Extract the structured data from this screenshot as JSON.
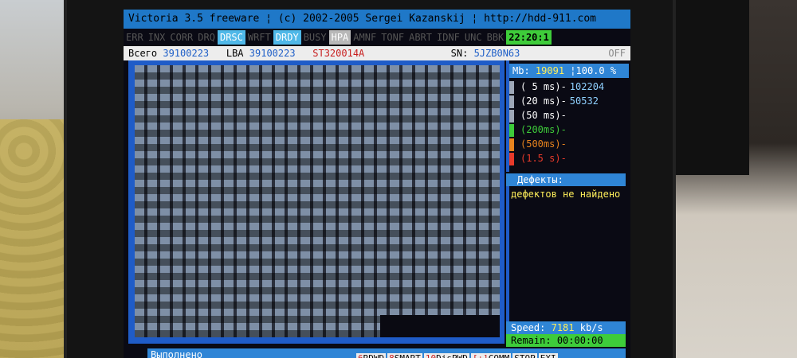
{
  "title": "Victoria 3.5 freeware ¦  (c) 2002-2005  Sergei Kazanskij  ¦ http://hdd-911.com",
  "flags": [
    {
      "label": "ERR",
      "state": "off"
    },
    {
      "label": "INX",
      "state": "off"
    },
    {
      "label": "CORR",
      "state": "off"
    },
    {
      "label": "DRQ",
      "state": "off"
    },
    {
      "label": "DRSC",
      "state": "on"
    },
    {
      "label": "WRFT",
      "state": "off"
    },
    {
      "label": "DRDY",
      "state": "on"
    },
    {
      "label": "BUSY",
      "state": "off"
    },
    {
      "label": "HPA",
      "state": "hpa"
    },
    {
      "label": "AMNF",
      "state": "off"
    },
    {
      "label": "TONF",
      "state": "off"
    },
    {
      "label": "ABRT",
      "state": "off"
    },
    {
      "label": "IDNF",
      "state": "off"
    },
    {
      "label": "UNC",
      "state": "off"
    },
    {
      "label": "BBK",
      "state": "off"
    }
  ],
  "clock": "22:20:1",
  "info": {
    "total_label": "Всего",
    "total_value": "39100223",
    "lba_label": "LBA",
    "lba_value": "39100223",
    "model": "ST320014A",
    "sn_label": "SN:",
    "sn_value": "5JZB0N63",
    "off_label": "OFF"
  },
  "stats": {
    "mb_label": "Mb:",
    "mb_value": "19091",
    "percent": "¦100.0 %",
    "rows": [
      {
        "label": "( 5 ms)-",
        "value": "102204",
        "color": "#ffffff",
        "bar": "#9ea8b8"
      },
      {
        "label": "(20 ms)-",
        "value": "50532",
        "color": "#ffffff",
        "bar": "#9ea8b8"
      },
      {
        "label": "(50 ms)-",
        "value": "",
        "color": "#ffffff",
        "bar": "#9ea8b8"
      },
      {
        "label": "(200ms)-",
        "value": "",
        "color": "#3ecc3a",
        "bar": "#3ecc3a"
      },
      {
        "label": "(500ms)-",
        "value": "",
        "color": "#e8841e",
        "bar": "#e8841e"
      },
      {
        "label": "(1.5 s)-",
        "value": "",
        "color": "#e83a2a",
        "bar": "#e83a2a"
      }
    ]
  },
  "defects": {
    "header": "Дефекты:",
    "message": "дефектов не найдено"
  },
  "speed": {
    "label": "Speed:",
    "value": "7181",
    "unit": "kb/s"
  },
  "remain": {
    "label": "Remain:",
    "value": "00:00:00"
  },
  "status_text": "Выполнено",
  "fkeys": [
    {
      "key": "6",
      "label": "RDWD"
    },
    {
      "key": "8",
      "label": "SMART"
    },
    {
      "key": "10",
      "label": "DisPWD"
    },
    {
      "key": "[+]",
      "label": "COMM"
    },
    {
      "key": "",
      "label": "STOP"
    },
    {
      "key": "",
      "label": "EXI"
    }
  ]
}
